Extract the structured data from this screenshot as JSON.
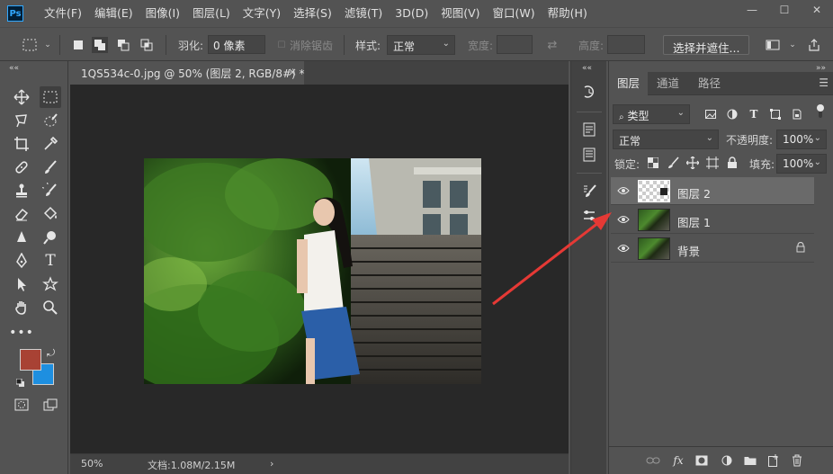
{
  "app": {
    "logo_text": "Ps"
  },
  "menubar": {
    "items": [
      "文件(F)",
      "编辑(E)",
      "图像(I)",
      "图层(L)",
      "文字(Y)",
      "选择(S)",
      "滤镜(T)",
      "3D(D)",
      "视图(V)",
      "窗口(W)",
      "帮助(H)"
    ],
    "minimize": "—",
    "maximize": "☐",
    "close": "✕"
  },
  "options": {
    "feather_label": "羽化:",
    "feather_value": "0 像素",
    "antialias_label": "消除锯齿",
    "style_label": "样式:",
    "style_value": "正常",
    "width_label": "宽度:",
    "height_label": "高度:",
    "select_mask_button": "选择并遮住..."
  },
  "document": {
    "tab_title": "1QS534c-0.jpg @ 50% (图层 2, RGB/8#) *",
    "tab_close": "×",
    "zoom": "50%",
    "doc_info": "文档:1.08M/2.15M",
    "status_arrow": "›"
  },
  "layers_panel": {
    "tabs": [
      "图层",
      "通道",
      "路径"
    ],
    "filter_kind": "类型",
    "blend_mode": "正常",
    "opacity_label": "不透明度:",
    "opacity_value": "100%",
    "lock_label": "锁定:",
    "fill_label": "填充:",
    "fill_value": "100%",
    "layers": [
      {
        "name": "图层 2",
        "selected": true,
        "thumb": "transparent"
      },
      {
        "name": "图层 1",
        "selected": false,
        "thumb": "photo"
      },
      {
        "name": "背景",
        "selected": false,
        "thumb": "photo",
        "locked": true
      }
    ]
  },
  "colors": {
    "foreground": "#a84234",
    "background": "#1e8fe0",
    "annotation_arrow": "#e53935"
  }
}
